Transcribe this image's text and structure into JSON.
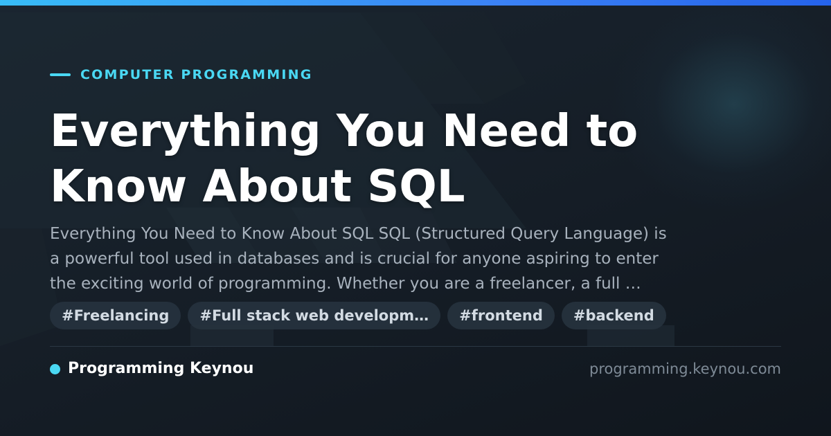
{
  "header": {
    "category": "COMPUTER PROGRAMMING",
    "title_lines": [
      "Everything You Need to",
      "Know About SQL"
    ]
  },
  "excerpt": {
    "lines": [
      "Everything You Need to Know About SQL SQL (Structured Query Language) is",
      "a powerful tool used in databases and is crucial for anyone aspiring to enter",
      "the exciting world of programming. Whether you are a freelancer, a full …"
    ]
  },
  "tags": [
    "#Freelancing",
    "#Full stack web developm…",
    "#frontend",
    "#backend"
  ],
  "footer": {
    "brand_name": "Programming Keynou",
    "domain": "programming.keynou.com"
  },
  "colors": {
    "accent": "#4ad8f3",
    "background": "#151d26",
    "top_bar": "#3b82f6",
    "title": "#ffffff",
    "excerpt": "#a8b2bd",
    "muted": "#7e8a96"
  }
}
